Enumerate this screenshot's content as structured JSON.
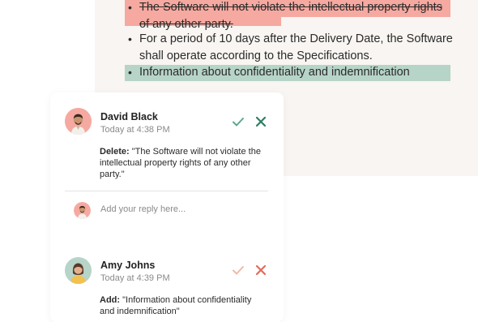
{
  "document": {
    "deleted_bullet": "The Software will not violate the intellectual property rights of any other party.",
    "normal_bullet": "For a period of 10 days after the Delivery Date, the Software shall operate according to the Specifications.",
    "added_bullet": "Information about confidentiality and indemnification",
    "bullet_glyph": "•",
    "colors": {
      "deleted_highlight": "#f6a9a0",
      "added_highlight": "#b7d4c8",
      "panel": "#f8f5f2"
    }
  },
  "comments": [
    {
      "author": "David Black",
      "time": "Today at 4:38 PM",
      "action_label": "Delete:",
      "action_text": "\"The Software will not violate the intellectual property rights of any other party.\"",
      "accept_icon": "check-icon",
      "reject_icon": "close-icon",
      "accept_color": "#5aa98a",
      "reject_color": "#2f7d62"
    },
    {
      "author": "Amy Johns",
      "time": "Today at 4:39 PM",
      "action_label": "Add:",
      "action_text": "\"Information about confidentiality and indemnification\"",
      "accept_icon": "check-icon",
      "reject_icon": "close-icon",
      "accept_color": "#f2b9a6",
      "reject_color": "#e26b5a"
    }
  ],
  "reply": {
    "placeholder": "Add your reply here..."
  }
}
